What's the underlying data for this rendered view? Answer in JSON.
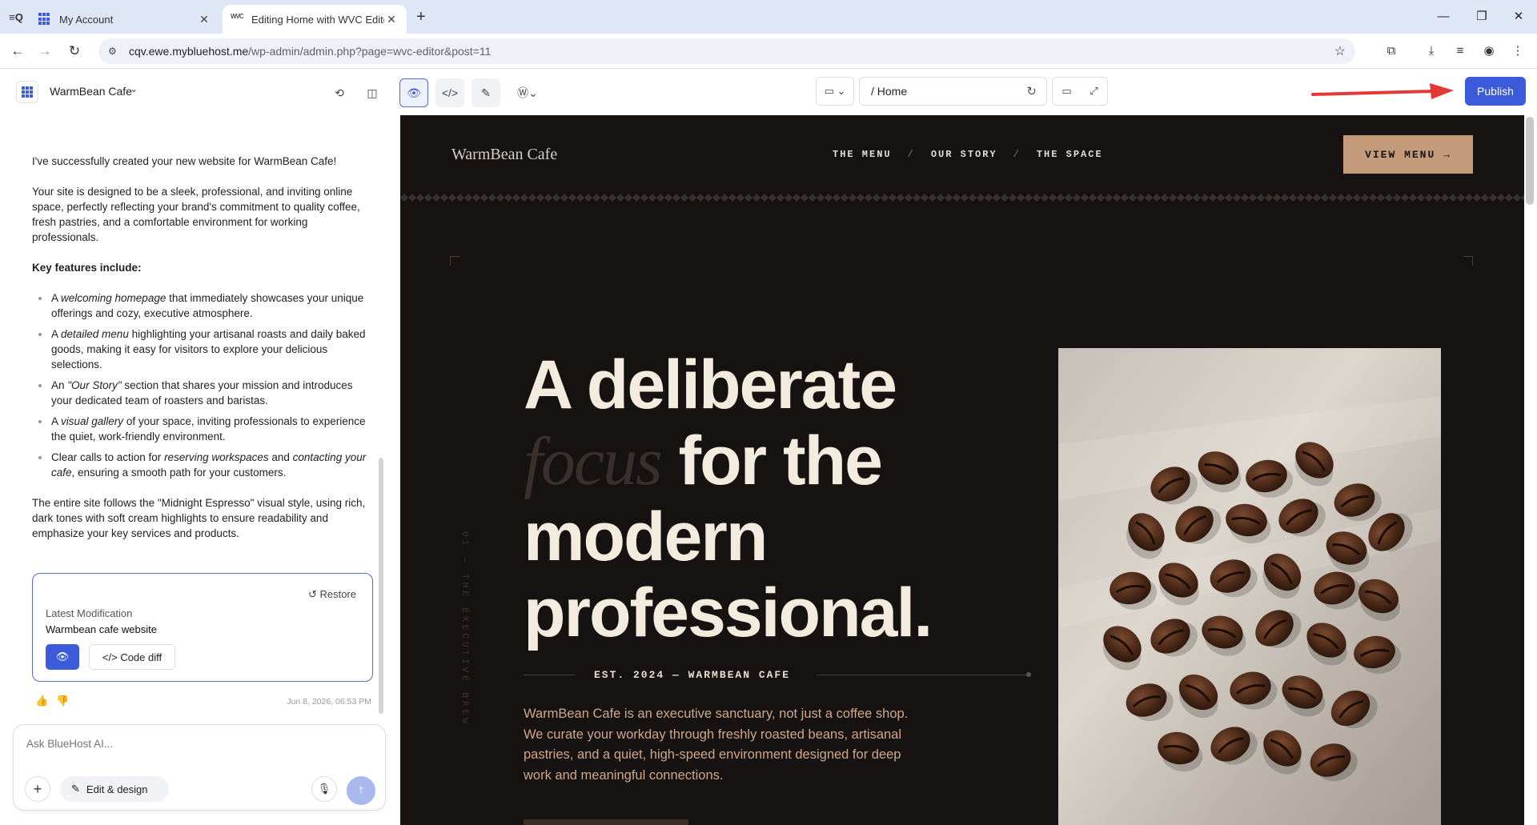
{
  "browser": {
    "tabs": [
      {
        "label": "My Account",
        "active": false
      },
      {
        "label": "Editing Home with WVC Editor",
        "active": true
      }
    ],
    "url_host": "cqv.ewe.mybluehost.me",
    "url_path": "/wp-admin/admin.php?page=wvc-editor&post=11"
  },
  "editor": {
    "site_name": "WarmBean Cafe",
    "page_path": "/ Home",
    "publish_label": "Publish",
    "accent": "#3b5bdb"
  },
  "chat": {
    "intro": "I've successfully created your new website for WarmBean Cafe!",
    "description": "Your site is designed to be a sleek, professional, and inviting online space, perfectly reflecting your brand's commitment to quality coffee, fresh pastries, and a comfortable environment for working professionals.",
    "features_heading": "Key features include:",
    "features": [
      {
        "pre": "A ",
        "em": "welcoming homepage",
        "post": " that immediately showcases your unique offerings and cozy, executive atmosphere."
      },
      {
        "pre": "A ",
        "em": "detailed menu",
        "post": " highlighting your artisanal roasts and daily baked goods, making it easy for visitors to explore your delicious selections."
      },
      {
        "pre": "An ",
        "em": "\"Our Story\"",
        "post": " section that shares your mission and introduces your dedicated team of roasters and baristas."
      },
      {
        "pre": "A ",
        "em": "visual gallery",
        "post": " of your space, inviting professionals to experience the quiet, work-friendly environment."
      },
      {
        "pre": "Clear calls to action for ",
        "em": "reserving workspaces",
        "mid": " and ",
        "em2": "contacting your cafe",
        "post": ", ensuring a smooth path for your customers."
      }
    ],
    "closing": "The entire site follows the \"Midnight Espresso\" visual style, using rich, dark tones with soft cream highlights to ensure readability and emphasize your key services and products.",
    "restore_label": "Restore",
    "mod_label": "Latest Modification",
    "mod_value": "Warmbean cafe website",
    "code_diff_label": "Code diff",
    "timestamp": "Jun 8, 2026, 06:53 PM",
    "input_placeholder": "Ask BlueHost AI...",
    "edit_design_label": "Edit & design"
  },
  "preview": {
    "logo": "WarmBean Cafe",
    "nav": [
      "THE MENU",
      "OUR STORY",
      "THE SPACE"
    ],
    "nav_sep": "/",
    "cta": "VIEW MENU →",
    "vertical_text": "01 — THE EXECUTIVE BREW",
    "headline_1": "A deliberate",
    "headline_italic": "focus",
    "headline_2": " for the",
    "headline_3": "modern",
    "headline_4": "professional.",
    "est": "EST. 2024 — WARMBEAN CAFE",
    "body": "WarmBean Cafe is an executive sanctuary, not just a coffee shop. We curate your workday through freshly roasted beans, artisanal pastries, and a quiet, high-speed environment designed for deep work and meaningful connections.",
    "bg_color": "#161211",
    "cream": "#f4ebdf",
    "accent": "#c39a7a"
  }
}
